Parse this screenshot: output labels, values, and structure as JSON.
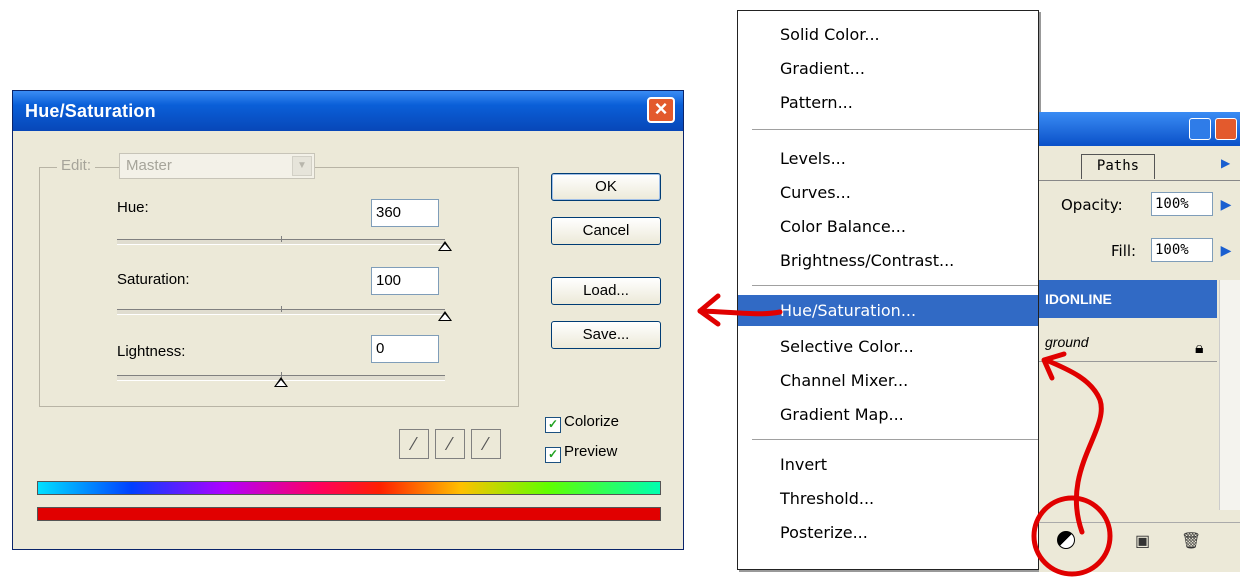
{
  "dialog": {
    "title": "Hue/Saturation",
    "edit": {
      "label": "Edit:",
      "value": "Master"
    },
    "fields": [
      {
        "label": "Hue:",
        "value": "360",
        "slider_fraction": 1.0
      },
      {
        "label": "Saturation:",
        "value": "100",
        "slider_fraction": 1.0
      },
      {
        "label": "Lightness:",
        "value": "0",
        "slider_fraction": 0.5
      }
    ],
    "buttons": {
      "ok": "OK",
      "cancel": "Cancel",
      "load": "Load...",
      "save": "Save..."
    },
    "checkboxes": {
      "colorize": "Colorize",
      "preview": "Preview"
    },
    "colors": {
      "title_bar": "#0a5fd8",
      "colorize_bar": "#e10000",
      "selection": "#316ac5"
    }
  },
  "menu": {
    "groups": [
      [
        "Solid Color...",
        "Gradient...",
        "Pattern..."
      ],
      [
        "Levels...",
        "Curves...",
        "Color Balance...",
        "Brightness/Contrast..."
      ],
      [
        "Hue/Saturation...",
        "Selective Color...",
        "Channel Mixer...",
        "Gradient Map..."
      ],
      [
        "Invert",
        "Threshold...",
        "Posterize..."
      ]
    ],
    "selected": "Hue/Saturation..."
  },
  "layers_panel": {
    "tab": "Paths",
    "opacity_label": "Opacity:",
    "opacity_value": "100%",
    "fill_label": "Fill:",
    "fill_value": "100%",
    "selected_layer": "IDONLINE",
    "background_layer": "ground"
  }
}
